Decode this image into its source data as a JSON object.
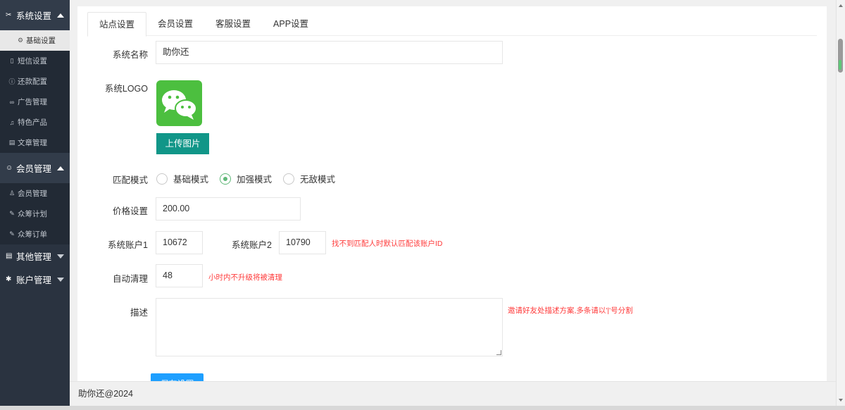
{
  "sidebar": {
    "groups": [
      {
        "label": "系统设置",
        "icon": "tools-icon",
        "expanded": true,
        "items": [
          {
            "label": "基础设置",
            "icon": "gear-icon",
            "active": true
          },
          {
            "label": "短信设置",
            "icon": "phone-icon"
          },
          {
            "label": "还款配置",
            "icon": "info-icon"
          },
          {
            "label": "广告管理",
            "icon": "link-icon"
          },
          {
            "label": "特色产品",
            "icon": "bell-icon"
          },
          {
            "label": "文章管理",
            "icon": "list-icon"
          }
        ]
      },
      {
        "label": "会员管理",
        "icon": "users-icon",
        "expanded": true,
        "items": [
          {
            "label": "会员管理",
            "icon": "user-icon"
          },
          {
            "label": "众筹计划",
            "icon": "edit-icon"
          },
          {
            "label": "众筹订单",
            "icon": "edit-icon"
          }
        ]
      },
      {
        "label": "其他管理",
        "icon": "doc-icon",
        "expanded": false
      },
      {
        "label": "账户管理",
        "icon": "gear-icon",
        "expanded": false
      }
    ]
  },
  "tabs": [
    "站点设置",
    "会员设置",
    "客服设置",
    "APP设置"
  ],
  "form": {
    "site_name_label": "系统名称",
    "site_name_value": "助你还",
    "logo_label": "系统LOGO",
    "upload_label": "上传图片",
    "match_mode_label": "匹配模式",
    "match_modes": [
      "基础模式",
      "加强模式",
      "无敌模式"
    ],
    "match_mode_selected": "加强模式",
    "price_label": "价格设置",
    "price_value": "200.00",
    "account1_label": "系统账户1",
    "account1_value": "10672",
    "account2_label": "系统账户2",
    "account2_value": "10790",
    "account_hint": "找不到匹配人时默认匹配该账户ID",
    "auto_clean_label": "自动清理",
    "auto_clean_value": "48",
    "auto_clean_hint": "小时内不升级将被清理",
    "desc_label": "描述",
    "desc_value": "",
    "desc_hint": "邀请好友处描述方案,多条请以'|'号分割",
    "save_label": "保存设置"
  },
  "footer": {
    "text": "助你还@2024"
  },
  "colors": {
    "sidebar": "#2a3340",
    "primary": "#119688",
    "radio_on": "#5fb878",
    "hint": "#ff3b3b",
    "button": "#1e9fff",
    "logo": "#4cbf3f"
  }
}
